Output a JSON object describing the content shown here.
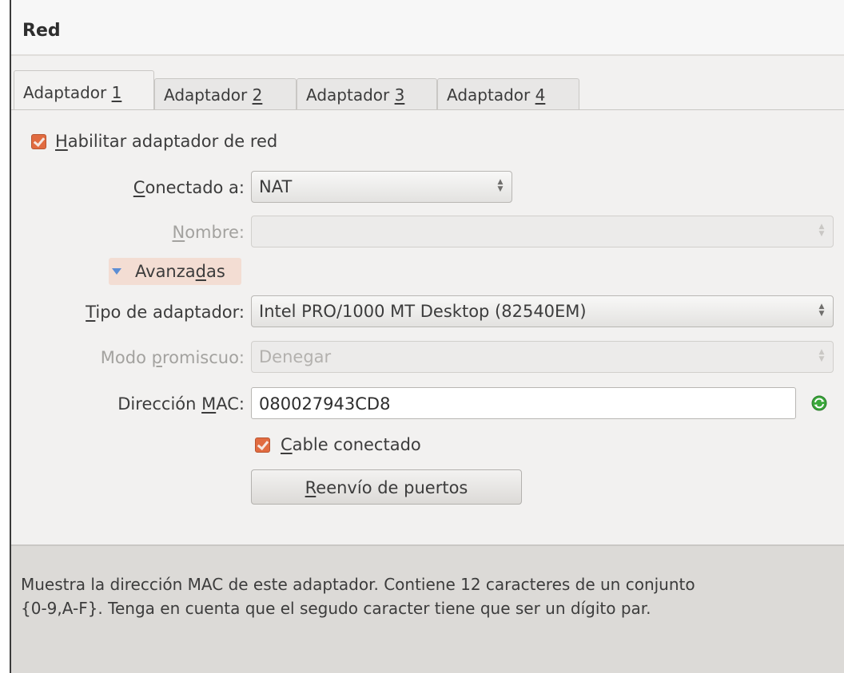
{
  "window": {
    "title": "Red"
  },
  "tabs": [
    {
      "pre": "Adaptador ",
      "mnemonic": "1",
      "active": true
    },
    {
      "pre": "Adaptador ",
      "mnemonic": "2",
      "active": false
    },
    {
      "pre": "Adaptador ",
      "mnemonic": "3",
      "active": false
    },
    {
      "pre": "Adaptador ",
      "mnemonic": "4",
      "active": false
    }
  ],
  "enable_adapter": {
    "mnemonic": "H",
    "rest": "abilitar adaptador de red",
    "checked": true
  },
  "connected_to": {
    "mnemonic": "C",
    "rest": "onectado a:",
    "value": "NAT"
  },
  "name": {
    "pre": "",
    "mnemonic": "N",
    "rest": "ombre:",
    "value": "",
    "disabled": true
  },
  "advanced": {
    "pre": "Avanza",
    "mnemonic": "d",
    "rest": "as",
    "expanded": true
  },
  "adapter_type": {
    "mnemonic": "T",
    "rest": "ipo de adaptador:",
    "value": "Intel PRO/1000 MT Desktop (82540EM)"
  },
  "promiscuous": {
    "pre": "Modo ",
    "mnemonic": "p",
    "rest": "romiscuo:",
    "value": "Denegar",
    "disabled": true
  },
  "mac": {
    "pre": "Dirección ",
    "mnemonic": "M",
    "rest": "AC:",
    "value": "080027943CD8"
  },
  "cable_connected": {
    "mnemonic": "C",
    "rest": "able conectado",
    "checked": true
  },
  "port_forwarding": {
    "mnemonic": "R",
    "rest": "eenvío de puertos"
  },
  "info": {
    "line1": "Muestra la dirección MAC de este adaptador. Contiene 12 caracteres de un conjunto",
    "line2": "{0-9,A-F}. Tenga en cuenta que el segudo caracter tiene que ser un dígito par."
  },
  "colors": {
    "accent": "#e16b40",
    "expander_bg": "#f3ddd3",
    "refresh_icon": "#3aa73a",
    "info_bg": "#dcdad7"
  }
}
